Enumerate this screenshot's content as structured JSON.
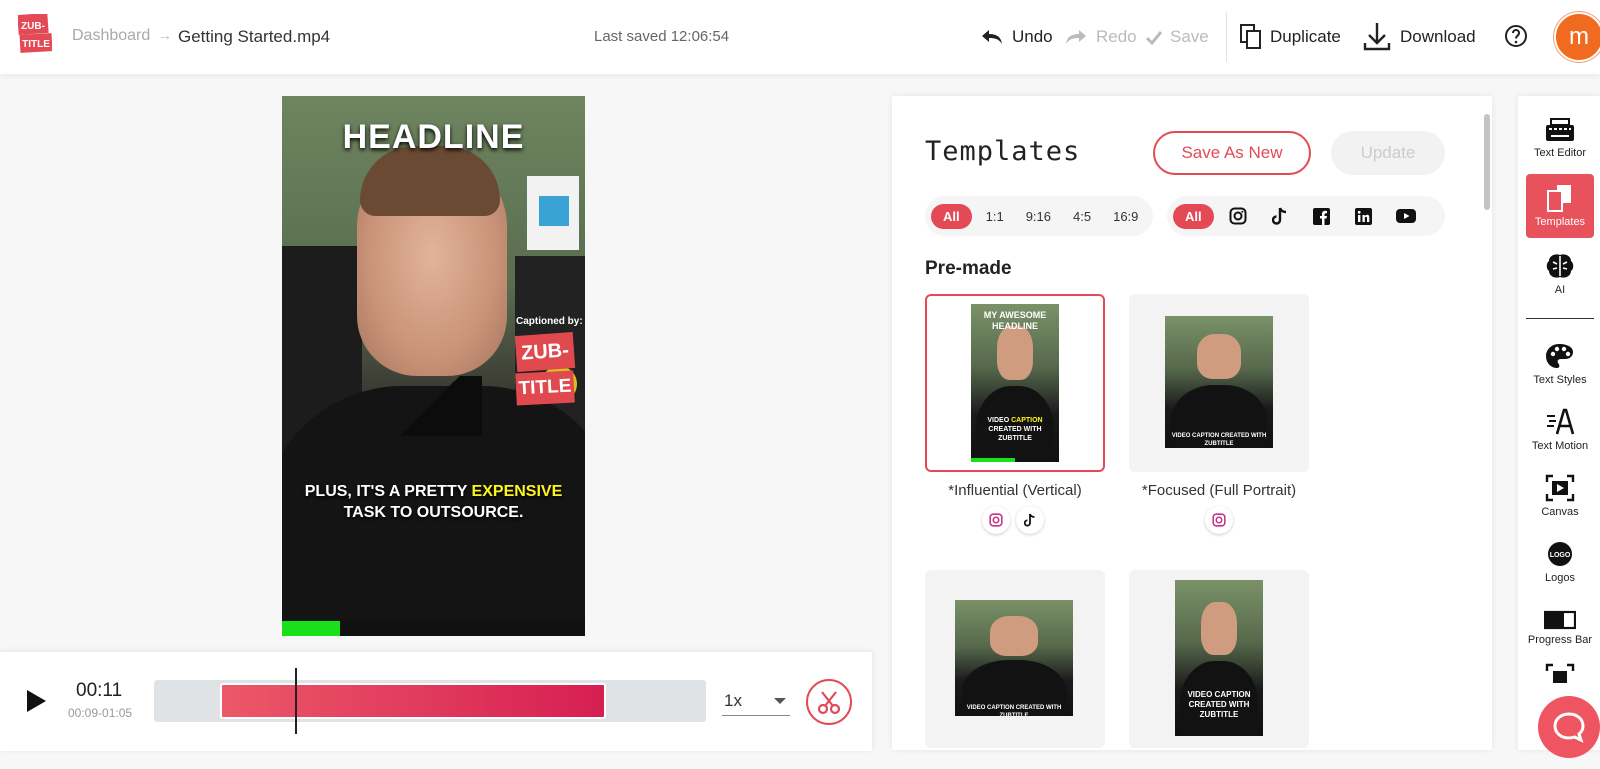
{
  "header": {
    "logo_line1": "ZUB-",
    "logo_line2": "TITLE",
    "breadcrumb_link": "Dashboard",
    "breadcrumb_sep": "→",
    "file_name": "Getting Started.mp4",
    "last_saved": "Last saved 12:06:54",
    "undo_label": "Undo",
    "redo_label": "Redo",
    "save_label": "Save",
    "duplicate_label": "Duplicate",
    "download_label": "Download",
    "avatar_initial": "m"
  },
  "video": {
    "headline": "HEADLINE",
    "captioned_by": "Captioned by:",
    "badge_line1": "ZUB-",
    "badge_line2": "TITLE",
    "caption_part1": "PLUS, IT'S A PRETTY ",
    "caption_highlight": "EXPENSIVE",
    "caption_part2": "TASK TO OUTSOURCE.",
    "progress": 0.19
  },
  "timeline": {
    "current_time": "00:11",
    "range": "00:09-01:05",
    "speed": "1x",
    "selection_start": 0.12,
    "selection_end": 0.82,
    "playhead": 0.255
  },
  "templates": {
    "title": "Templates",
    "save_as_new": "Save As New",
    "update": "Update",
    "ratio_filters": [
      "All",
      "1:1",
      "9:16",
      "4:5",
      "16:9"
    ],
    "platform_filter_all": "All",
    "platform_icons": [
      "instagram-icon",
      "tiktok-icon",
      "facebook-icon",
      "linkedin-icon",
      "youtube-icon"
    ],
    "section_label": "Pre-made",
    "cards": [
      {
        "label": "*Influential (Vertical)",
        "thumb_top": "MY AWESOME HEADLINE",
        "thumb_bottom_a": "VIDEO ",
        "thumb_bottom_hl": "CAPTION",
        "thumb_bottom_b": " CREATED WITH ZUBTITLE",
        "platforms": [
          "instagram-icon",
          "tiktok-icon"
        ]
      },
      {
        "label": "*Focused (Full Portrait)",
        "thumb_bottom": "VIDEO CAPTION CREATED WITH ZUBTITLE",
        "platforms": [
          "instagram-icon"
        ]
      },
      {
        "label": "",
        "thumb_bottom": "VIDEO CAPTION CREATED WITH ZUBTITLE"
      },
      {
        "label": "",
        "thumb_bottom": "VIDEO CAPTION CREATED WITH ZUBTITLE"
      }
    ]
  },
  "rail": {
    "tools": [
      "Text Editor",
      "Templates",
      "AI",
      "Text Styles",
      "Text Motion",
      "Canvas",
      "Logos",
      "Progress Bar"
    ],
    "active": "Templates"
  },
  "colors": {
    "accent": "#e34a55",
    "progress_green": "#19e019",
    "avatar": "#f06a1f"
  }
}
